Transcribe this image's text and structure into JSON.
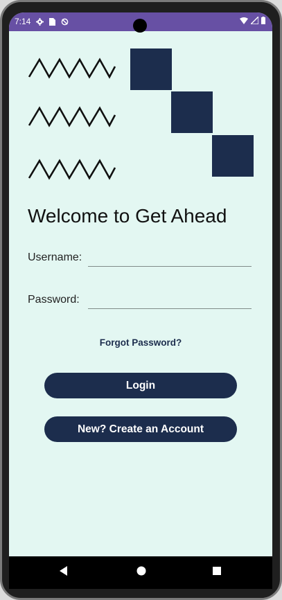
{
  "status_bar": {
    "time": "7:14",
    "icons_left": [
      "settings-icon",
      "sim-card-icon",
      "sync-icon"
    ],
    "icons_right": [
      "wifi-icon",
      "signal-icon",
      "battery-icon"
    ],
    "color": "#6750a4"
  },
  "theme": {
    "background": "#e3f7f2",
    "primary": "#1c2d4d"
  },
  "main": {
    "title": "Welcome to Get Ahead",
    "username_label": "Username:",
    "username_value": "",
    "password_label": "Password:",
    "password_value": "",
    "forgot_password": "Forgot Password?",
    "login_button": "Login",
    "create_account_button": "New? Create an Account"
  },
  "nav_bar": {
    "icons": [
      "back-icon",
      "home-icon",
      "recents-icon"
    ]
  }
}
